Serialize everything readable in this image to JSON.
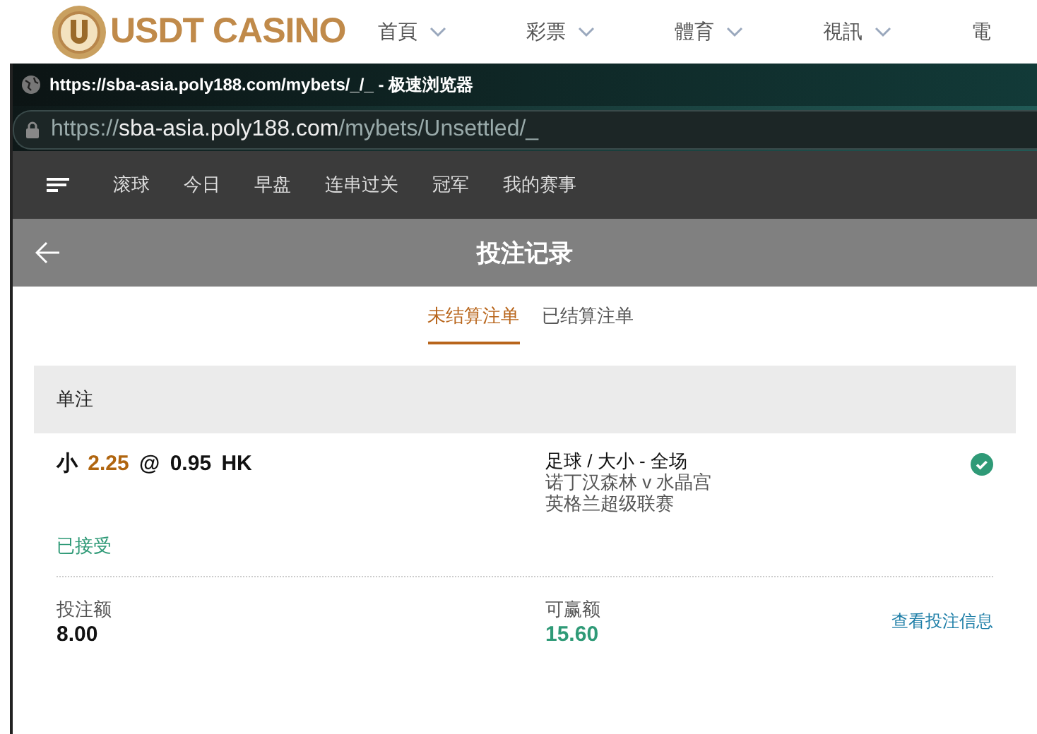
{
  "site_header": {
    "logo_text": "USDT CASINO",
    "nav": [
      {
        "label": "首頁",
        "dropdown": true
      },
      {
        "label": "彩票",
        "dropdown": true
      },
      {
        "label": "體育",
        "dropdown": true
      },
      {
        "label": "視訊",
        "dropdown": true
      },
      {
        "label": "電",
        "dropdown": false
      }
    ]
  },
  "browser": {
    "title": "https://sba-asia.poly188.com/mybets/_/_ - 极速浏览器",
    "address": {
      "scheme": "https://",
      "host": "sba-asia.poly188.com",
      "path": "/mybets/Unsettled/_"
    }
  },
  "app_nav": {
    "items": [
      "滚球",
      "今日",
      "早盘",
      "连串过关",
      "冠军",
      "我的赛事"
    ]
  },
  "page_header": {
    "title": "投注记录"
  },
  "tabs": [
    {
      "label": "未结算注单",
      "selected": true
    },
    {
      "label": "已结算注单",
      "selected": false
    }
  ],
  "bet": {
    "type": "单注",
    "selection": "小",
    "line": "2.25",
    "at": "@",
    "odds": "0.95 HK",
    "market": "足球 / 大小 - 全场",
    "match": "诺丁汉森林 v 水晶宫",
    "league": "英格兰超级联赛",
    "confirmed": true,
    "status": "已接受",
    "stake_label": "投注额",
    "stake": "8.00",
    "win_label": "可赢额",
    "win": "15.60",
    "details_link": "查看投注信息"
  }
}
